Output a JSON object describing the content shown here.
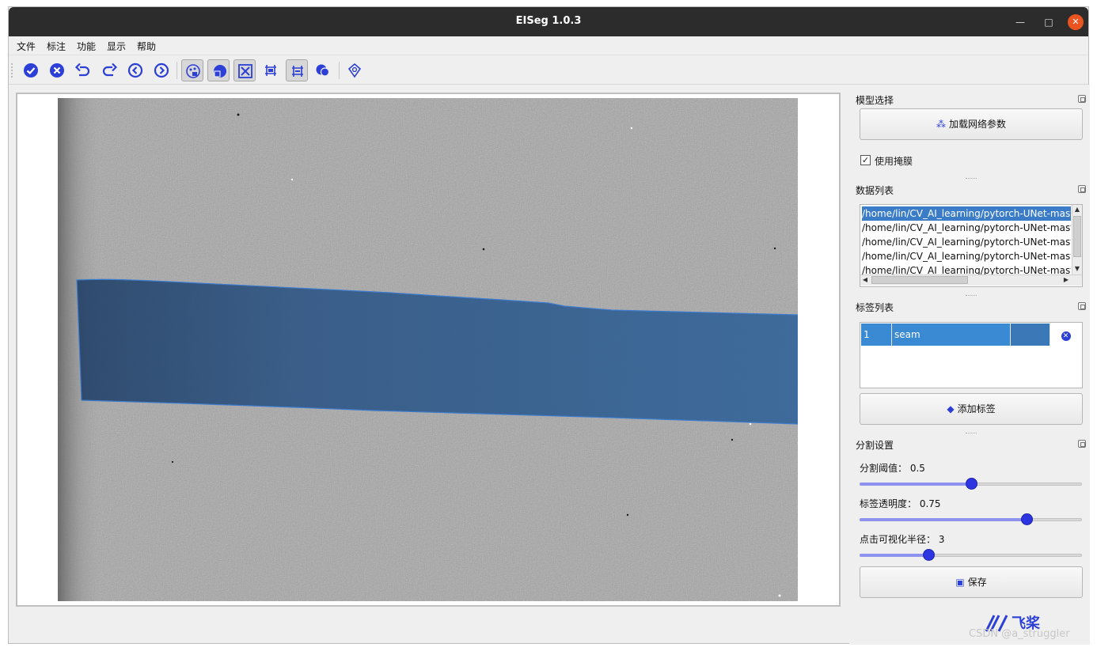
{
  "window": {
    "title": "EISeg 1.0.3",
    "minimize": "—",
    "maximize": "□",
    "close": "✕"
  },
  "menu": [
    "文件",
    "标注",
    "功能",
    "显示",
    "帮助"
  ],
  "toolbar": {
    "tools": [
      {
        "icon": "finish-icon",
        "checked": false
      },
      {
        "icon": "clear-icon",
        "checked": false
      },
      {
        "icon": "undo-icon",
        "checked": false
      },
      {
        "icon": "redo-icon",
        "checked": false
      },
      {
        "icon": "prev-image-icon",
        "checked": false
      },
      {
        "icon": "next-image-icon",
        "checked": false
      },
      {
        "icon": "save-pseudo-color-icon",
        "checked": true
      },
      {
        "icon": "save-grayscale-icon",
        "checked": true
      },
      {
        "icon": "save-json-icon",
        "checked": true
      },
      {
        "icon": "save-coco-icon",
        "checked": false
      },
      {
        "icon": "auto-save-icon",
        "checked": true
      },
      {
        "icon": "show-mask-icon",
        "checked": false
      },
      {
        "icon": "shortcut-settings-icon",
        "checked": false
      }
    ]
  },
  "model_panel": {
    "title": "模型选择",
    "load_button": "加载网络参数",
    "use_mask_label": "使用掩膜",
    "use_mask_checked": true
  },
  "data_panel": {
    "title": "数据列表",
    "files": [
      "/home/lin/CV_AI_learning/pytorch-UNet-master",
      "/home/lin/CV_AI_learning/pytorch-UNet-master",
      "/home/lin/CV_AI_learning/pytorch-UNet-master",
      "/home/lin/CV_AI_learning/pytorch-UNet-master",
      "/home/lin/CV_AI_learning/pytorch-UNet-master"
    ],
    "selected_index": 0
  },
  "label_panel": {
    "title": "标签列表",
    "labels": [
      {
        "id": "1",
        "name": "seam",
        "color": "#3a78b8"
      }
    ],
    "add_button": "添加标签"
  },
  "seg_panel": {
    "title": "分割设置",
    "threshold_label": "分割阈值：",
    "threshold_value": "0.5",
    "threshold_fraction": 0.5,
    "opacity_label": "标签透明度：",
    "opacity_value": "0.75",
    "opacity_fraction": 0.75,
    "radius_label": "点击可视化半径：",
    "radius_value": "3",
    "radius_fraction": 0.31,
    "save_button": "保存"
  },
  "branding": {
    "logo_text": "飞桨",
    "watermark": "CSDN @a_struggler"
  },
  "colors": {
    "accent": "#2c3fd6",
    "selection": "#3a7cc7",
    "mask": "#2a6ab6",
    "titlebar": "#2c2c2c"
  }
}
